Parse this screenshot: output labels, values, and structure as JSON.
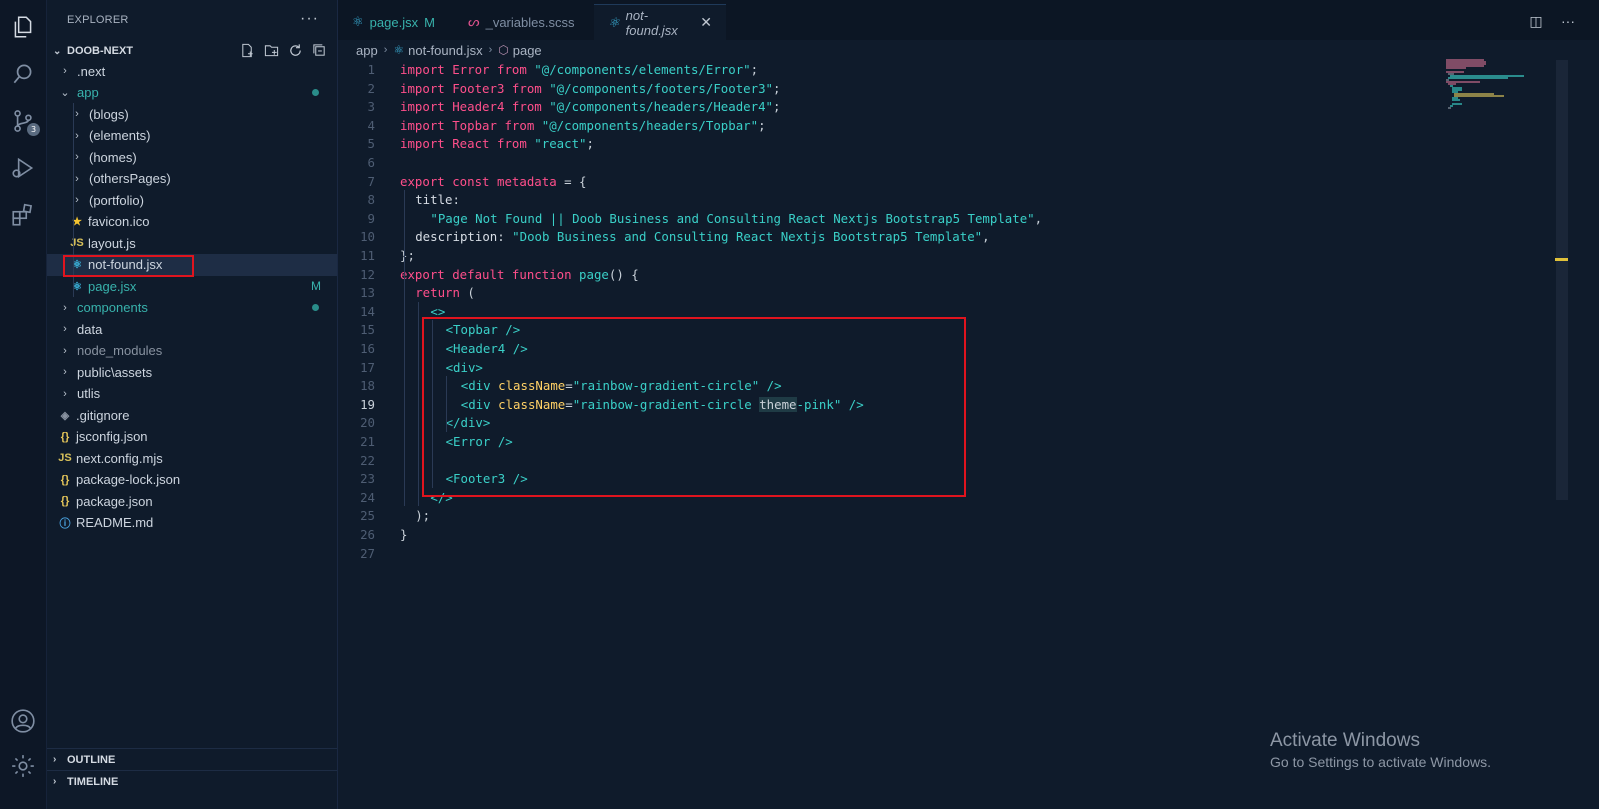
{
  "explorer": {
    "title": "EXPLORER",
    "more_label": "···",
    "root_label": "DOOB-NEXT",
    "tree": [
      {
        "label": ".next",
        "depth": 0,
        "kind": "folder",
        "expanded": false
      },
      {
        "label": "app",
        "depth": 0,
        "kind": "folder",
        "expanded": true,
        "color": "#38b2ac",
        "dot": true
      },
      {
        "label": "(blogs)",
        "depth": 1,
        "kind": "folder",
        "expanded": false
      },
      {
        "label": "(elements)",
        "depth": 1,
        "kind": "folder",
        "expanded": false
      },
      {
        "label": "(homes)",
        "depth": 1,
        "kind": "folder",
        "expanded": false
      },
      {
        "label": "(othersPages)",
        "depth": 1,
        "kind": "folder",
        "expanded": false
      },
      {
        "label": "(portfolio)",
        "depth": 1,
        "kind": "folder",
        "expanded": false
      },
      {
        "label": "favicon.ico",
        "depth": 1,
        "kind": "file",
        "icon": "★",
        "icon_color": "#f4c430"
      },
      {
        "label": "layout.js",
        "depth": 1,
        "kind": "file",
        "icon": "JS",
        "icon_color": "#d8c15a"
      },
      {
        "label": "not-found.jsx",
        "depth": 1,
        "kind": "file",
        "icon": "⚛",
        "icon_color": "#3ab0d8",
        "selected": true
      },
      {
        "label": "page.jsx",
        "depth": 1,
        "kind": "file",
        "icon": "⚛",
        "icon_color": "#3ab0d8",
        "color": "#38b2ac",
        "badge": "M"
      },
      {
        "label": "components",
        "depth": 0,
        "kind": "folder",
        "expanded": false,
        "color": "#38b2ac",
        "dot": true
      },
      {
        "label": "data",
        "depth": 0,
        "kind": "folder",
        "expanded": false
      },
      {
        "label": "node_modules",
        "depth": 0,
        "kind": "folder",
        "expanded": false,
        "color": "#8892a0"
      },
      {
        "label": "public\\assets",
        "depth": 0,
        "kind": "folder",
        "expanded": false
      },
      {
        "label": "utlis",
        "depth": 0,
        "kind": "folder",
        "expanded": false
      },
      {
        "label": ".gitignore",
        "depth": 0,
        "kind": "file",
        "icon": "◈",
        "icon_color": "#8892a0"
      },
      {
        "label": "jsconfig.json",
        "depth": 0,
        "kind": "file",
        "icon": "{}",
        "icon_color": "#e6c75a"
      },
      {
        "label": "next.config.mjs",
        "depth": 0,
        "kind": "file",
        "icon": "JS",
        "icon_color": "#d8c15a"
      },
      {
        "label": "package-lock.json",
        "depth": 0,
        "kind": "file",
        "icon": "{}",
        "icon_color": "#e6c75a"
      },
      {
        "label": "package.json",
        "depth": 0,
        "kind": "file",
        "icon": "{}",
        "icon_color": "#e6c75a"
      },
      {
        "label": "README.md",
        "depth": 0,
        "kind": "file",
        "icon": "ⓘ",
        "icon_color": "#4aa3e0"
      }
    ],
    "outline_label": "OUTLINE",
    "timeline_label": "TIMELINE"
  },
  "activity": {
    "source_control_badge": "3"
  },
  "tabs": [
    {
      "label": "page.jsx",
      "modifier": "M",
      "icon": "⚛",
      "icon_color": "#3ab0d8",
      "color": "#38b2ac",
      "active": false
    },
    {
      "label": "_variables.scss",
      "modifier": "",
      "icon": "ᔕ",
      "icon_color": "#e0528e",
      "color": "#7f8ea3",
      "active": false
    },
    {
      "label": "not-found.jsx",
      "modifier": "",
      "icon": "⚛",
      "icon_color": "#3ab0d8",
      "color": "#aab4c3",
      "active": true,
      "close": "✕"
    }
  ],
  "breadcrumb": {
    "segments": [
      "app",
      "not-found.jsx",
      "page"
    ]
  },
  "editor": {
    "current_line": 19,
    "lines": [
      {
        "n": "1",
        "indent": 0,
        "tokens": [
          [
            "k",
            "import "
          ],
          [
            "v",
            "Error"
          ],
          [
            "k",
            " from "
          ],
          [
            "s",
            "\"@/components/elements/Error\""
          ],
          [
            "p",
            ";"
          ]
        ]
      },
      {
        "n": "2",
        "indent": 0,
        "tokens": [
          [
            "k",
            "import "
          ],
          [
            "v",
            "Footer3"
          ],
          [
            "k",
            " from "
          ],
          [
            "s",
            "\"@/components/footers/Footer3\""
          ],
          [
            "p",
            ";"
          ]
        ]
      },
      {
        "n": "3",
        "indent": 0,
        "tokens": [
          [
            "k",
            "import "
          ],
          [
            "v",
            "Header4"
          ],
          [
            "k",
            " from "
          ],
          [
            "s",
            "\"@/components/headers/Header4\""
          ],
          [
            "p",
            ";"
          ]
        ]
      },
      {
        "n": "4",
        "indent": 0,
        "tokens": [
          [
            "k",
            "import "
          ],
          [
            "v",
            "Topbar"
          ],
          [
            "k",
            " from "
          ],
          [
            "s",
            "\"@/components/headers/Topbar\""
          ],
          [
            "p",
            ";"
          ]
        ]
      },
      {
        "n": "5",
        "indent": 0,
        "tokens": [
          [
            "k",
            "import "
          ],
          [
            "v",
            "React"
          ],
          [
            "k",
            " from "
          ],
          [
            "s",
            "\"react\""
          ],
          [
            "p",
            ";"
          ]
        ]
      },
      {
        "n": "6",
        "indent": 0,
        "tokens": []
      },
      {
        "n": "7",
        "indent": 0,
        "tokens": [
          [
            "k",
            "export const "
          ],
          [
            "v",
            "metadata"
          ],
          [
            "p",
            " = {"
          ]
        ]
      },
      {
        "n": "8",
        "indent": 2,
        "tokens": [
          [
            "pr",
            "title"
          ],
          [
            "p",
            ":"
          ]
        ]
      },
      {
        "n": "9",
        "indent": 4,
        "tokens": [
          [
            "s",
            "\"Page Not Found || Doob Business and Consulting React Nextjs Bootstrap5 Template\""
          ],
          [
            "p",
            ","
          ]
        ]
      },
      {
        "n": "10",
        "indent": 2,
        "tokens": [
          [
            "pr",
            "description"
          ],
          [
            "p",
            ": "
          ],
          [
            "s",
            "\"Doob Business and Consulting React Nextjs Bootstrap5 Template\""
          ],
          [
            "p",
            ","
          ]
        ]
      },
      {
        "n": "11",
        "indent": 0,
        "tokens": [
          [
            "p",
            "};"
          ]
        ]
      },
      {
        "n": "12",
        "indent": 0,
        "tokens": [
          [
            "k",
            "export default "
          ],
          [
            "k",
            "function "
          ],
          [
            "f",
            "page"
          ],
          [
            "p",
            "() {"
          ]
        ]
      },
      {
        "n": "13",
        "indent": 2,
        "tokens": [
          [
            "k",
            "return "
          ],
          [
            "p",
            "("
          ]
        ]
      },
      {
        "n": "14",
        "indent": 4,
        "tokens": [
          [
            "t",
            "<>"
          ]
        ]
      },
      {
        "n": "15",
        "indent": 6,
        "tokens": [
          [
            "t",
            "<Topbar "
          ],
          [
            "t",
            "/>"
          ]
        ]
      },
      {
        "n": "16",
        "indent": 6,
        "tokens": [
          [
            "t",
            "<Header4 "
          ],
          [
            "t",
            "/>"
          ]
        ]
      },
      {
        "n": "17",
        "indent": 6,
        "tokens": [
          [
            "t",
            "<div>"
          ]
        ]
      },
      {
        "n": "18",
        "indent": 8,
        "tokens": [
          [
            "t",
            "<div "
          ],
          [
            "a",
            "className"
          ],
          [
            "p",
            "="
          ],
          [
            "s",
            "\"rainbow-gradient-circle\""
          ],
          [
            "t",
            " />"
          ]
        ]
      },
      {
        "n": "19",
        "indent": 8,
        "tokens": [
          [
            "t",
            "<div "
          ],
          [
            "a",
            "className"
          ],
          [
            "p",
            "="
          ],
          [
            "s",
            "\"rainbow-gradient-circle "
          ],
          [
            "hl",
            "theme"
          ],
          [
            "s",
            "-pink\""
          ],
          [
            "t",
            " />"
          ]
        ]
      },
      {
        "n": "20",
        "indent": 6,
        "tokens": [
          [
            "t",
            "</div>"
          ]
        ]
      },
      {
        "n": "21",
        "indent": 6,
        "tokens": [
          [
            "t",
            "<Error "
          ],
          [
            "t",
            "/>"
          ]
        ]
      },
      {
        "n": "22",
        "indent": 0,
        "tokens": []
      },
      {
        "n": "23",
        "indent": 6,
        "tokens": [
          [
            "t",
            "<Footer3 "
          ],
          [
            "t",
            "/>"
          ]
        ]
      },
      {
        "n": "24",
        "indent": 4,
        "tokens": [
          [
            "t",
            "</>"
          ]
        ]
      },
      {
        "n": "25",
        "indent": 2,
        "tokens": [
          [
            "p",
            ");"
          ]
        ]
      },
      {
        "n": "26",
        "indent": 0,
        "tokens": [
          [
            "p",
            "}"
          ]
        ]
      },
      {
        "n": "27",
        "indent": 0,
        "tokens": []
      }
    ]
  },
  "watermark": {
    "line1": "Activate Windows",
    "line2": "Go to Settings to activate Windows."
  },
  "colors": {
    "accent": "#38b2ac",
    "highlight_box": "#e0141e",
    "keyword": "#ff4f8b",
    "string": "#3ad0c8"
  }
}
